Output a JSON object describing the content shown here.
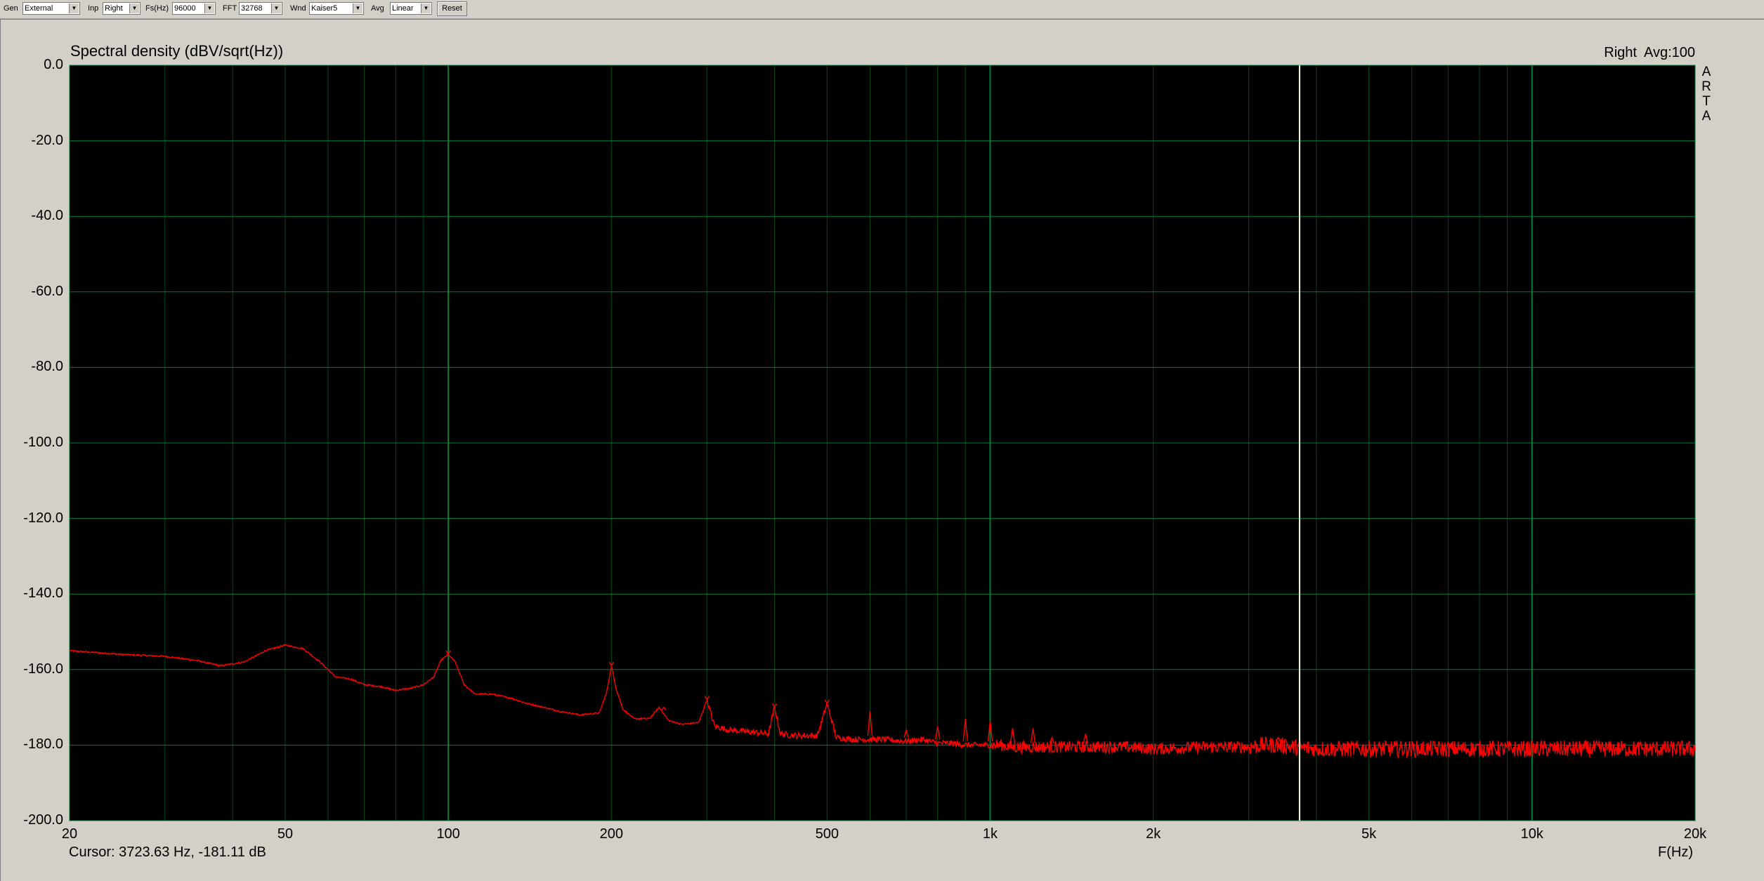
{
  "toolbar": {
    "gen_label": "Gen",
    "gen_value": "External",
    "inp_label": "Inp",
    "inp_value": "Right",
    "fs_label": "Fs(Hz)",
    "fs_value": "96000",
    "fft_label": "FFT",
    "fft_value": "32768",
    "wnd_label": "Wnd",
    "wnd_value": "Kaiser5",
    "avg_label": "Avg",
    "avg_value": "Linear",
    "reset_label": "Reset"
  },
  "plot": {
    "title": "Spectral density (dBV/sqrt(Hz))",
    "channel": "Right",
    "avg": "Avg:100",
    "logo_letters": [
      "A",
      "R",
      "T",
      "A"
    ],
    "cursor_readout": "Cursor: 3723.63 Hz, -181.11 dB",
    "x_unit": "F(Hz)"
  },
  "colors": {
    "background": "#000000",
    "grid": "#00803c",
    "trace": "#ff0000",
    "cursor": "#ffffe0"
  },
  "chart_data": {
    "type": "line",
    "title": "Spectral density (dBV/sqrt(Hz))",
    "xlabel": "F(Hz)",
    "ylabel": "",
    "x_scale": "log",
    "xlim": [
      20,
      20000
    ],
    "ylim": [
      -200,
      0
    ],
    "x_ticks": [
      20,
      50,
      100,
      200,
      500,
      1000,
      2000,
      5000,
      10000,
      20000
    ],
    "x_tick_labels": [
      "20",
      "50",
      "100",
      "200",
      "500",
      "1k",
      "2k",
      "5k",
      "10k",
      "20k"
    ],
    "y_ticks": [
      0,
      -20,
      -40,
      -60,
      -80,
      -100,
      -120,
      -140,
      -160,
      -180,
      -200
    ],
    "y_tick_labels": [
      "0.0",
      "-20.0",
      "-40.0",
      "-60.0",
      "-80.0",
      "-100.0",
      "-120.0",
      "-140.0",
      "-160.0",
      "-180.0",
      "-200.0"
    ],
    "grid": true,
    "cursor": {
      "x": 3723.63,
      "y": -181.11
    },
    "series": [
      {
        "name": "Right",
        "x": [
          20,
          25,
          30,
          34,
          38,
          42,
          46,
          50,
          54,
          58,
          62,
          66,
          70,
          75,
          80,
          85,
          90,
          94,
          97,
          100,
          103,
          107,
          112,
          120,
          130,
          140,
          150,
          160,
          175,
          190,
          196,
          200,
          204,
          210,
          220,
          235,
          245,
          255,
          270,
          290,
          300,
          310,
          330,
          360,
          390,
          400,
          410,
          440,
          480,
          500,
          520,
          560,
          600,
          640,
          700,
          750,
          800,
          850,
          900,
          950,
          1000,
          1050,
          1100,
          1200,
          1300,
          1400,
          1500,
          1600,
          1800,
          2000,
          2500,
          3000,
          3200,
          3400,
          3600,
          4000,
          5000,
          6000,
          8000,
          10000,
          12000,
          15000,
          20000
        ],
        "y": [
          -155.0,
          -156.0,
          -156.5,
          -157.5,
          -159.0,
          -158.0,
          -155.0,
          -153.5,
          -154.5,
          -158.0,
          -162.0,
          -162.5,
          -164.0,
          -164.5,
          -165.5,
          -165.0,
          -164.0,
          -162.0,
          -157.5,
          -156.0,
          -158.0,
          -164.0,
          -166.5,
          -166.5,
          -167.5,
          -169.0,
          -170.0,
          -171.0,
          -172.0,
          -171.5,
          -166.0,
          -159.0,
          -165.0,
          -170.5,
          -173.0,
          -173.0,
          -170.0,
          -173.5,
          -174.5,
          -174.0,
          -168.0,
          -175.0,
          -176.0,
          -176.5,
          -177.0,
          -170.0,
          -177.0,
          -177.5,
          -177.5,
          -169.0,
          -178.0,
          -178.5,
          -178.5,
          -178.5,
          -179.0,
          -178.5,
          -179.5,
          -179.5,
          -180.0,
          -180.0,
          -180.0,
          -180.0,
          -180.5,
          -180.5,
          -180.5,
          -180.5,
          -180.5,
          -180.5,
          -180.5,
          -181.0,
          -180.5,
          -180.5,
          -180.0,
          -180.0,
          -180.5,
          -181.0,
          -181.0,
          -181.0,
          -181.0,
          -181.0,
          -181.0,
          -181.0,
          -181.0
        ]
      }
    ],
    "peaks": [
      {
        "x": 100,
        "y": -156.0
      },
      {
        "x": 200,
        "y": -159.0
      },
      {
        "x": 250,
        "y": -170.0
      },
      {
        "x": 300,
        "y": -168.0
      },
      {
        "x": 400,
        "y": -170.0
      },
      {
        "x": 500,
        "y": -169.0
      },
      {
        "x": 600,
        "y": -171.0
      },
      {
        "x": 700,
        "y": -176.0
      },
      {
        "x": 800,
        "y": -175.0
      },
      {
        "x": 900,
        "y": -173.0
      },
      {
        "x": 1000,
        "y": -173.5
      },
      {
        "x": 1100,
        "y": -175.5
      },
      {
        "x": 1200,
        "y": -175.5
      },
      {
        "x": 1300,
        "y": -178.0
      },
      {
        "x": 1500,
        "y": -177.0
      },
      {
        "x": 3300,
        "y": -178.5
      },
      {
        "x": 3400,
        "y": -178.0
      },
      {
        "x": 3500,
        "y": -178.5
      }
    ]
  }
}
